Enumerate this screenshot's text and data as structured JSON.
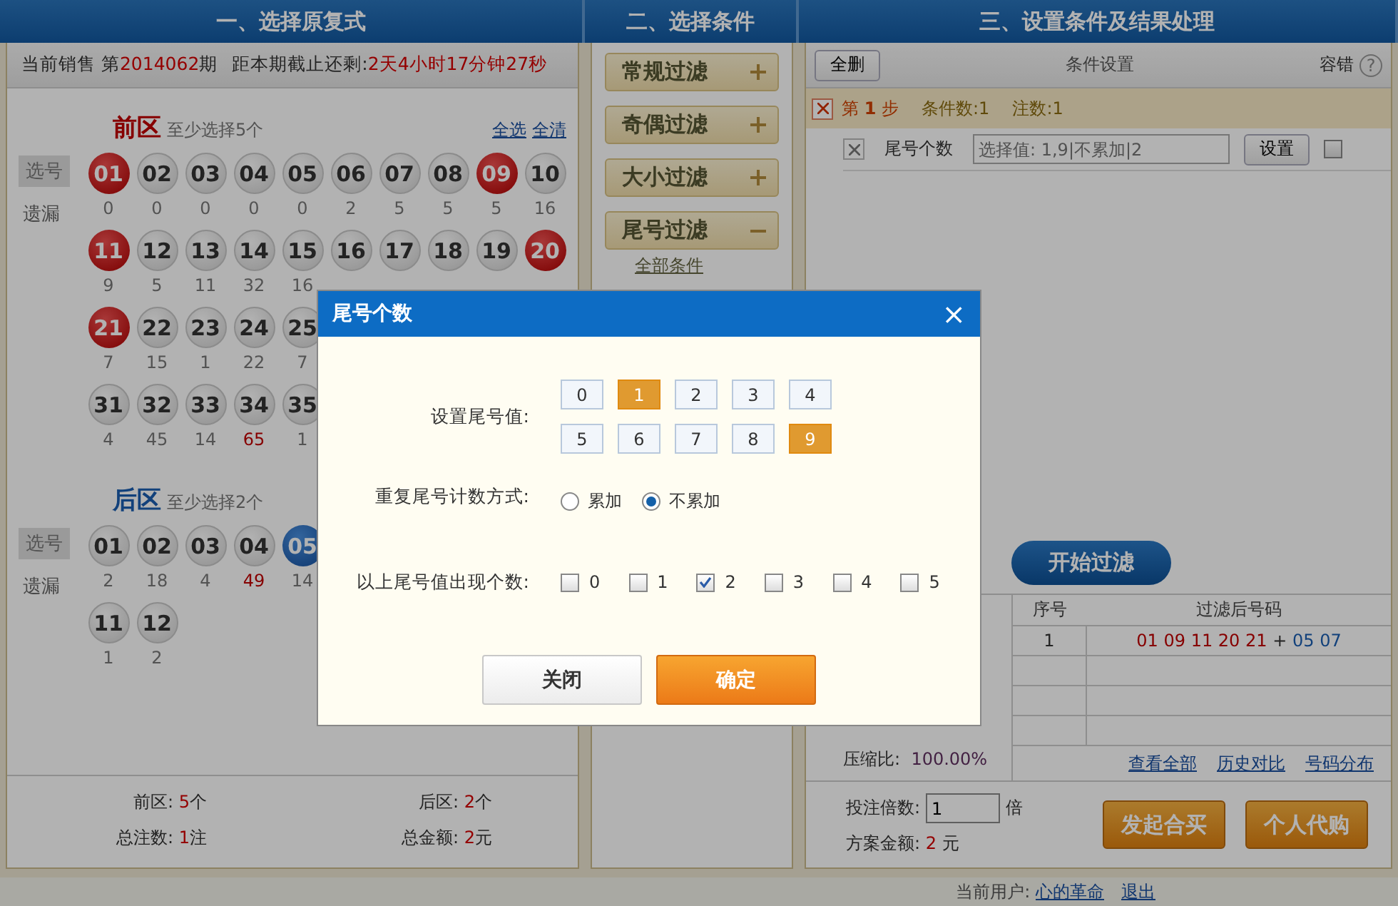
{
  "header_tabs": [
    {
      "label": "一、选择原复式"
    },
    {
      "label": "二、选择条件"
    },
    {
      "label": "三、设置条件及结果处理"
    }
  ],
  "sale_info": {
    "prefix": "当前销售 第",
    "issue": "2014062",
    "suffix": "期",
    "countdown_label": "距本期截止还剩:",
    "countdown": "2天4小时17分钟27秒"
  },
  "zones": [
    {
      "kind": "front",
      "title": "前区",
      "hint": "至少选择5个",
      "links": [
        "全选",
        "全清"
      ],
      "pick_label": "选号",
      "miss_label": "遗漏",
      "rows": [
        [
          {
            "number": "01",
            "selected": true,
            "miss": "0",
            "miss_hot": false
          },
          {
            "number": "02",
            "selected": false,
            "miss": "0",
            "miss_hot": false
          },
          {
            "number": "03",
            "selected": false,
            "miss": "0",
            "miss_hot": false
          },
          {
            "number": "04",
            "selected": false,
            "miss": "0",
            "miss_hot": false
          },
          {
            "number": "05",
            "selected": false,
            "miss": "0",
            "miss_hot": false
          },
          {
            "number": "06",
            "selected": false,
            "miss": "2",
            "miss_hot": false
          },
          {
            "number": "07",
            "selected": false,
            "miss": "5",
            "miss_hot": false
          },
          {
            "number": "08",
            "selected": false,
            "miss": "5",
            "miss_hot": false
          },
          {
            "number": "09",
            "selected": true,
            "miss": "5",
            "miss_hot": false
          },
          {
            "number": "10",
            "selected": false,
            "miss": "16",
            "miss_hot": false
          }
        ],
        [
          {
            "number": "11",
            "selected": true,
            "miss": "9",
            "miss_hot": false
          },
          {
            "number": "12",
            "selected": false,
            "miss": "5",
            "miss_hot": false
          },
          {
            "number": "13",
            "selected": false,
            "miss": "11",
            "miss_hot": false
          },
          {
            "number": "14",
            "selected": false,
            "miss": "32",
            "miss_hot": false
          },
          {
            "number": "15",
            "selected": false,
            "miss": "16",
            "miss_hot": false
          },
          {
            "number": "16",
            "selected": false
          },
          {
            "number": "17",
            "selected": false
          },
          {
            "number": "18",
            "selected": false
          },
          {
            "number": "19",
            "selected": false
          },
          {
            "number": "20",
            "selected": true
          }
        ],
        [
          {
            "number": "21",
            "selected": true,
            "miss": "7",
            "miss_hot": false
          },
          {
            "number": "22",
            "selected": false,
            "miss": "15",
            "miss_hot": false
          },
          {
            "number": "23",
            "selected": false,
            "miss": "1",
            "miss_hot": false
          },
          {
            "number": "24",
            "selected": false,
            "miss": "22",
            "miss_hot": false
          },
          {
            "number": "25",
            "selected": false,
            "miss": "7",
            "miss_hot": false
          }
        ],
        [
          {
            "number": "31",
            "selected": false,
            "miss": "4",
            "miss_hot": false
          },
          {
            "number": "32",
            "selected": false,
            "miss": "45",
            "miss_hot": false
          },
          {
            "number": "33",
            "selected": false,
            "miss": "14",
            "miss_hot": false
          },
          {
            "number": "34",
            "selected": false,
            "miss": "65",
            "miss_hot": true
          },
          {
            "number": "35",
            "selected": false,
            "miss": "1",
            "miss_hot": false
          }
        ]
      ]
    },
    {
      "kind": "back",
      "title": "后区",
      "hint": "至少选择2个",
      "pick_label": "选号",
      "miss_label": "遗漏",
      "rows": [
        [
          {
            "number": "01",
            "selected": false,
            "miss": "2",
            "miss_hot": false
          },
          {
            "number": "02",
            "selected": false,
            "miss": "18",
            "miss_hot": false
          },
          {
            "number": "03",
            "selected": false,
            "miss": "4",
            "miss_hot": false
          },
          {
            "number": "04",
            "selected": false,
            "miss": "49",
            "miss_hot": true
          },
          {
            "number": "05",
            "selected": true,
            "miss": "14",
            "miss_hot": false
          }
        ],
        [
          {
            "number": "11",
            "selected": false,
            "miss": "1",
            "miss_hot": false
          },
          {
            "number": "12",
            "selected": false,
            "miss": "2",
            "miss_hot": false
          }
        ]
      ]
    }
  ],
  "selection_summary": [
    {
      "label": "前区:",
      "value": "5",
      "unit": "个"
    },
    {
      "label": "后区:",
      "value": "2",
      "unit": "个"
    },
    {
      "label": "总注数:",
      "value": "1",
      "unit": "注"
    },
    {
      "label": "总金额:",
      "value": "2",
      "unit": "元"
    }
  ],
  "filters": [
    {
      "label": "常规过滤",
      "expanded": false
    },
    {
      "label": "奇偶过滤",
      "expanded": false
    },
    {
      "label": "大小过滤",
      "expanded": false
    },
    {
      "label": "尾号过滤",
      "expanded": true
    }
  ],
  "filters_link": "全部条件",
  "conditions": {
    "delete_all": "全删",
    "title": "条件设置",
    "tolerance": "容错",
    "help": "?",
    "step": {
      "prefix": "第",
      "number": "1",
      "suffix": "步",
      "count": "条件数:1",
      "bets": "注数:1"
    },
    "items": [
      {
        "name": "尾号个数",
        "placeholder": "选择值: 1,9|不累加|2",
        "button": "设置",
        "checked": false
      }
    ]
  },
  "start_button": "开始过滤",
  "stats": [
    {
      "label": "压缩比:",
      "value": "100.00%"
    }
  ],
  "results": {
    "columns": [
      "序号",
      "过滤后号码"
    ],
    "rows": [
      {
        "index": "1",
        "front": "01 09 11 20 21",
        "plus": "+",
        "back": "05 07"
      }
    ],
    "links": [
      "查看全部",
      "历史对比",
      "号码分布"
    ]
  },
  "order": {
    "multiple_label": "投注倍数:",
    "multiple": "1",
    "multiple_unit": "倍",
    "amount_label": "方案金额:",
    "amount": "2",
    "amount_unit": "元",
    "buttons": [
      "发起合买",
      "个人代购"
    ]
  },
  "status_bar": {
    "user_label": "当前用户:",
    "user": "心的革命",
    "logout": "退出"
  },
  "dialog": {
    "title": "尾号个数",
    "close": "×",
    "digits_label": "设置尾号值:",
    "digits": [
      {
        "label": "0",
        "selected": false
      },
      {
        "label": "1",
        "selected": true
      },
      {
        "label": "2",
        "selected": false
      },
      {
        "label": "3",
        "selected": false
      },
      {
        "label": "4",
        "selected": false
      },
      {
        "label": "5",
        "selected": false
      },
      {
        "label": "6",
        "selected": false
      },
      {
        "label": "7",
        "selected": false
      },
      {
        "label": "8",
        "selected": false
      },
      {
        "label": "9",
        "selected": true
      }
    ],
    "mode_label": "重复尾号计数方式:",
    "modes": [
      {
        "label": "累加",
        "selected": false
      },
      {
        "label": "不累加",
        "selected": true
      }
    ],
    "count_label": "以上尾号值出现个数:",
    "counts": [
      {
        "label": "0",
        "checked": false
      },
      {
        "label": "1",
        "checked": false
      },
      {
        "label": "2",
        "checked": true
      },
      {
        "label": "3",
        "checked": false
      },
      {
        "label": "4",
        "checked": false
      },
      {
        "label": "5",
        "checked": false
      }
    ],
    "buttons": [
      {
        "kind": "secondary",
        "label": "关闭"
      },
      {
        "kind": "primary",
        "label": "确定"
      }
    ]
  }
}
